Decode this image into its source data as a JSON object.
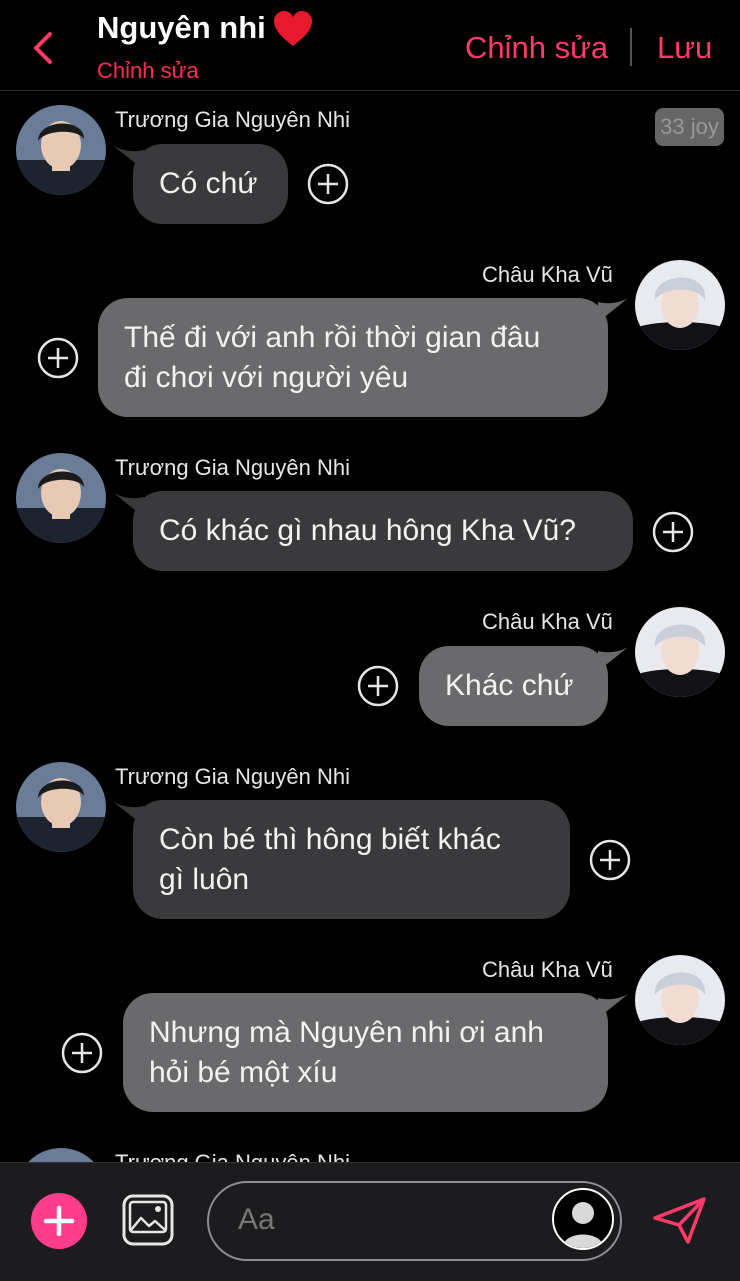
{
  "header": {
    "title": "Nguyên nhi",
    "subtitle": "Chỉnh sửa",
    "edit_label": "Chỉnh sửa",
    "save_label": "Lưu",
    "title_icon": "heart-icon",
    "back_icon": "chevron-left-icon"
  },
  "timestamp": "33 joy",
  "messages": [
    {
      "sender": "Trương Gia Nguyên Nhi",
      "side": "left",
      "lines": [
        "Có chứ"
      ]
    },
    {
      "sender": "Châu Kha Vũ",
      "side": "right",
      "lines": [
        "Thế đi với anh rồi thời gian đâu",
        "đi chơi với người yêu"
      ]
    },
    {
      "sender": "Trương Gia Nguyên Nhi",
      "side": "left",
      "lines": [
        "Có khác gì nhau hông Kha Vũ?"
      ]
    },
    {
      "sender": "Châu Kha Vũ",
      "side": "right",
      "lines": [
        "Khác chứ"
      ]
    },
    {
      "sender": "Trương Gia Nguyên Nhi",
      "side": "left",
      "lines": [
        "Còn bé thì hông biết khác",
        "gì luôn"
      ]
    },
    {
      "sender": "Châu Kha Vũ",
      "side": "right",
      "lines": [
        "Nhưng mà Nguyên nhi ơi anh",
        "hỏi bé một xíu"
      ]
    },
    {
      "sender": "Trương Gia Nguyên Nhi",
      "side": "left",
      "lines": []
    }
  ],
  "composer": {
    "placeholder": "Aa",
    "add_icon": "plus-icon",
    "image_icon": "image-icon",
    "avatar_icon": "person-silhouette-icon",
    "send_icon": "send-icon"
  },
  "colors": {
    "accent": "#ff3b6b",
    "add_button": "#ff3d8b",
    "incoming_bubble": "#3a3a3c",
    "outgoing_bubble": "#6a6a6c",
    "background": "#000000"
  }
}
